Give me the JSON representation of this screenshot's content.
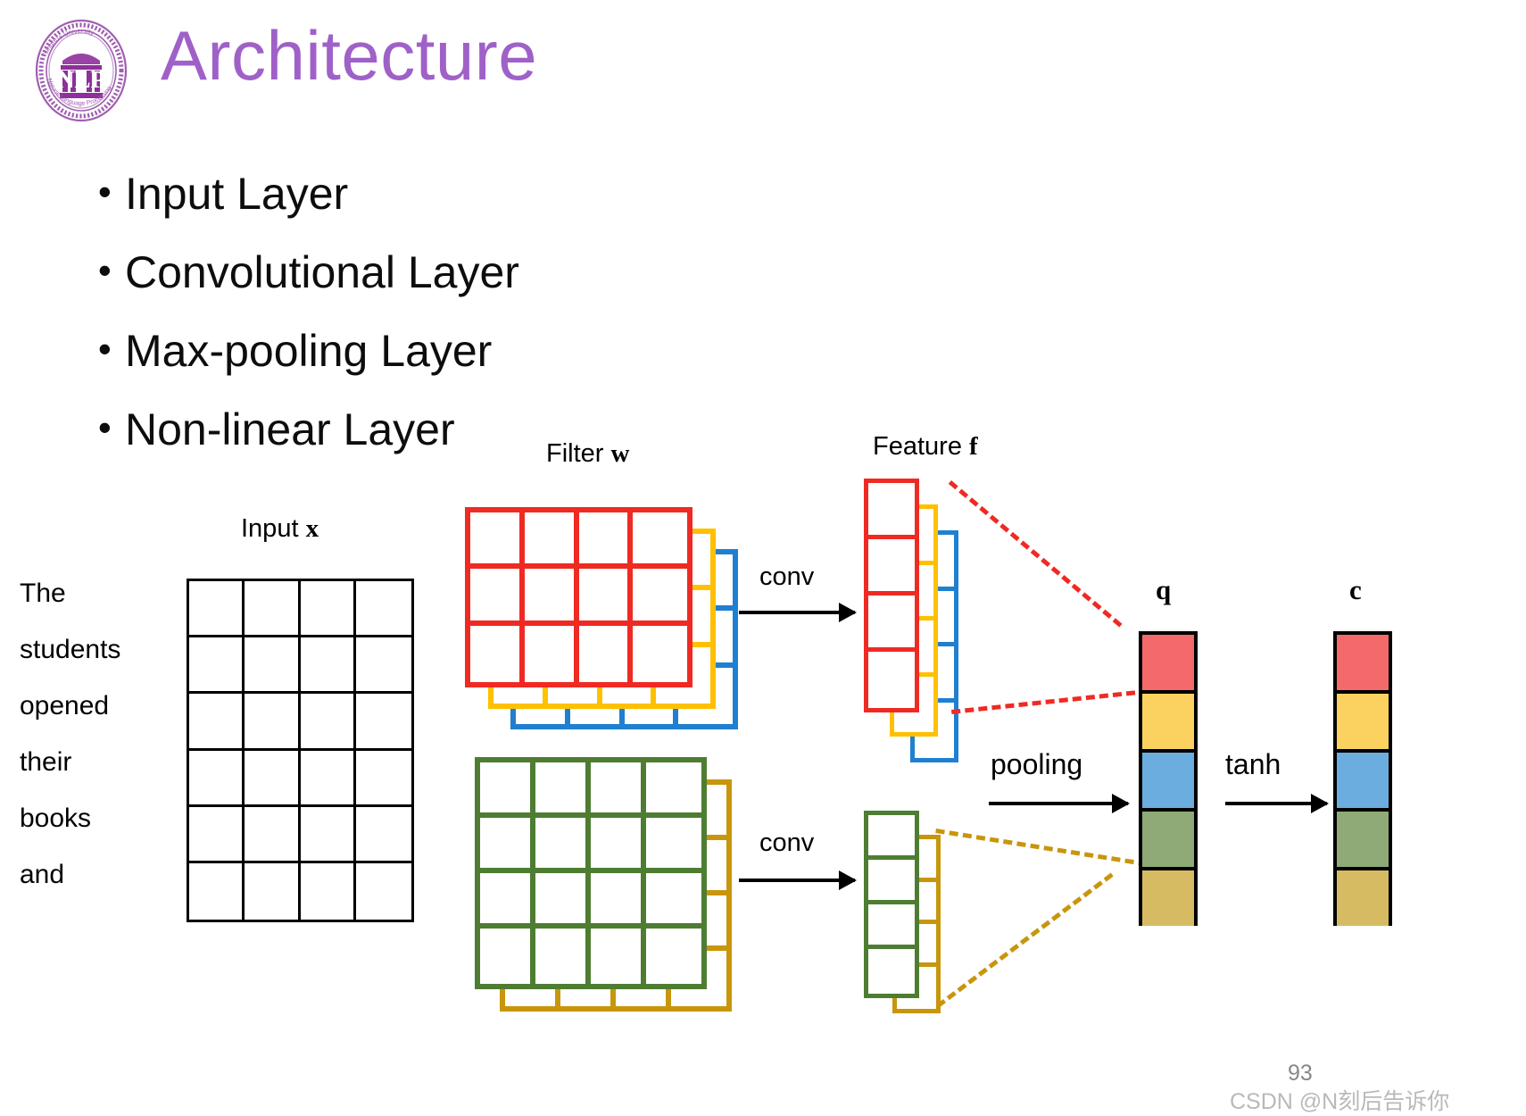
{
  "header": {
    "title": "Architecture",
    "title_color": "#9f61c8",
    "logo": {
      "name": "tsinghua-nlp-logo",
      "center_text": "NLP",
      "top_arc_text": "Tsinghua University",
      "bottom_arc_text": "Natural Language Processing",
      "color": "#9f4fa8"
    }
  },
  "bullets": [
    {
      "marker": "•",
      "label": "Input Layer"
    },
    {
      "marker": "•",
      "label": "Convolutional Layer"
    },
    {
      "marker": "•",
      "label": "Max-pooling Layer"
    },
    {
      "marker": "•",
      "label": "Non-linear Layer"
    }
  ],
  "diagram": {
    "labels": {
      "input": "Input ",
      "input_var": "x",
      "filter": "Filter ",
      "filter_var": "w",
      "feature": "Feature ",
      "feature_var": "f",
      "q": "q",
      "c": "c"
    },
    "operations": {
      "conv_top": "conv",
      "conv_bottom": "conv",
      "pooling": "pooling",
      "tanh": "tanh"
    },
    "sentence_words": [
      "The",
      "students",
      "opened",
      "their",
      "books",
      "and"
    ],
    "input_grid": {
      "cols": 4,
      "rows": 6,
      "color": "#000000"
    },
    "filter_stacks": [
      {
        "name": "filter-stack-top",
        "cols": 4,
        "rows": 3,
        "layers": [
          "#ef2a23",
          "#ffc000",
          "#1f7fd0"
        ]
      },
      {
        "name": "filter-stack-bottom",
        "cols": 4,
        "rows": 4,
        "layers": [
          "#4e7d32",
          "#c8960c"
        ]
      }
    ],
    "feature_stacks": [
      {
        "name": "feature-stack-top",
        "cells": 4,
        "layers": [
          "#ef2a23",
          "#ffc000",
          "#1f7fd0"
        ]
      },
      {
        "name": "feature-stack-bottom",
        "cells": 4,
        "layers": [
          "#4e7d32",
          "#c8960c"
        ]
      }
    ],
    "q_vector": {
      "cells": [
        "#f4696a",
        "#fbd25f",
        "#6caddf",
        "#8faa76",
        "#d6bb62"
      ],
      "border": "#000000"
    },
    "c_vector": {
      "cells": [
        "#f4696a",
        "#fbd25f",
        "#6caddf",
        "#8faa76",
        "#d6bb62"
      ],
      "border": "#000000"
    }
  },
  "footer": {
    "page_number": "93",
    "watermark": "CSDN @N刻后告诉你"
  }
}
